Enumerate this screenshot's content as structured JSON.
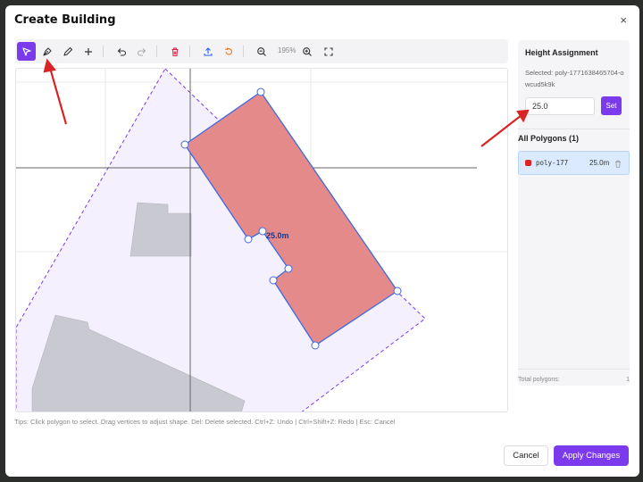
{
  "dialog": {
    "title": "Create Building",
    "close_glyph": "×"
  },
  "toolbar": {
    "tools": [
      "select-icon",
      "pen-icon",
      "pencil-icon",
      "plus-icon",
      "undo-icon",
      "redo-icon",
      "trash-icon",
      "upload-icon",
      "reset-icon",
      "zoom-out-icon",
      "zoom-in-icon",
      "fullscreen-icon"
    ],
    "zoom_level": "195%",
    "accent": "#7c3aed"
  },
  "canvas": {
    "polygon_label": "25.0m",
    "polygon_fill": "#e58a8a",
    "polygon_stroke": "#4169e1"
  },
  "tips": "Tips: Click polygon to select. Drag vertices to adjust shape. Del: Delete selected.   Ctrl+Z: Undo | Ctrl+Shift+Z: Redo | Esc: Cancel",
  "panel": {
    "height_title": "Height Assignment",
    "selected_text": "Selected: poly-1771638465704-owcud5k9k",
    "height_value": "25.0",
    "set_label": "Set",
    "all_polygons_title": "All Polygons (1)",
    "polygons": [
      {
        "name": "poly-177",
        "height": "25.0m",
        "color": "#dc2626"
      }
    ],
    "total_label": "Total polygons:",
    "total_value": "1"
  },
  "footer": {
    "cancel_label": "Cancel",
    "apply_label": "Apply Changes"
  }
}
